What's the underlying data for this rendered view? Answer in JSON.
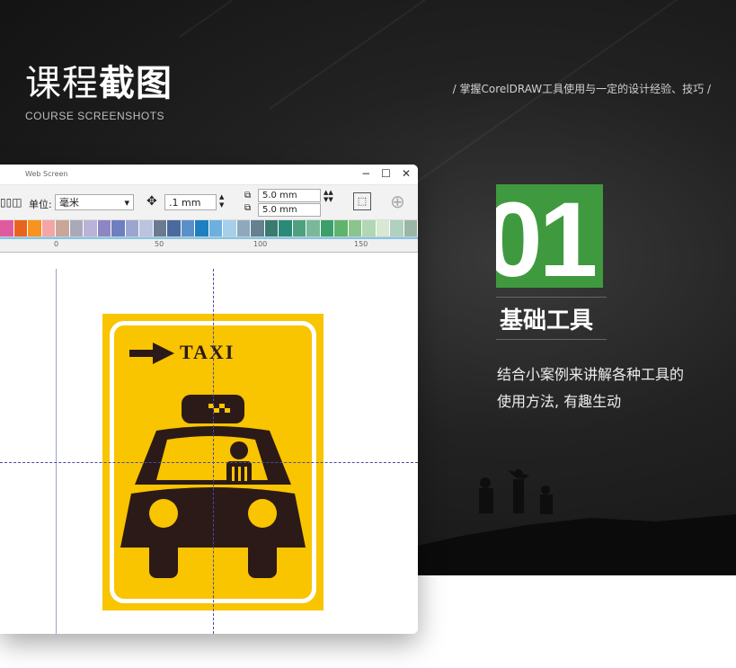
{
  "header": {
    "title_light": "课程",
    "title_bold": "截图",
    "subtitle": "COURSE SCREENSHOTS",
    "slogan": "/  掌握CorelDRAW工具使用与一定的设计经验、技巧  /"
  },
  "section": {
    "number": "01",
    "title": "基础工具",
    "desc_line1": "结合小案例来讲解各种工具的",
    "desc_line2": "使用方法, 有趣生动",
    "accent_color": "#3f9a3f"
  },
  "window": {
    "title": "Web Screen",
    "controls": [
      "−",
      "☐",
      "✕"
    ],
    "toolbar": {
      "unit_label": "单位:",
      "unit_value": "毫米",
      "nudge_value": ".1 mm",
      "dup_x": "5.0 mm",
      "dup_y": "5.0 mm"
    },
    "ruler_labels": [
      "0",
      "50",
      "100",
      "150"
    ],
    "palette": [
      "#e05aa0",
      "#e8641e",
      "#f7931e",
      "#f2a6a6",
      "#c8a79a",
      "#a9a9b8",
      "#b9b3d8",
      "#8d86c4",
      "#6e7fc0",
      "#9aa6cf",
      "#bcc3de",
      "#6b7a8f",
      "#4a6a9e",
      "#5b8fc7",
      "#1e7fc1",
      "#6cb0e0",
      "#a7cfe9",
      "#8ea9bd",
      "#65808f",
      "#3b7a6e",
      "#2a8a77",
      "#4fa07f",
      "#7ab89a",
      "#3a9f6a",
      "#5fb36c",
      "#8cc48d",
      "#b1d7b3",
      "#d7e9d3",
      "#b0d0c0",
      "#9ab6a5"
    ],
    "sign_text": "TAXI"
  }
}
